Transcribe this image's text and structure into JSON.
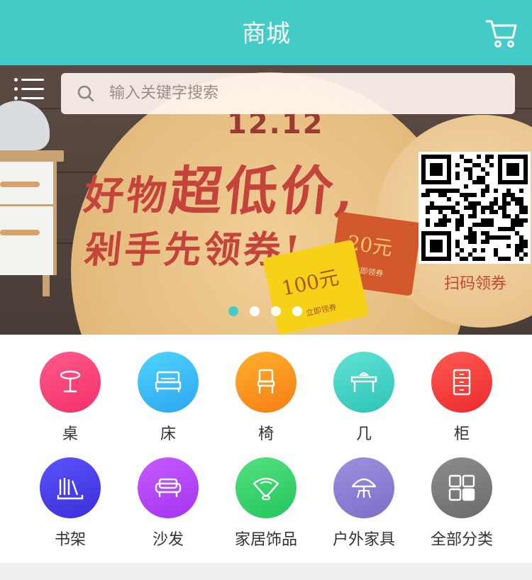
{
  "header": {
    "title": "商城",
    "cart_icon": "cart-icon"
  },
  "colors": {
    "accent": "#43cbc8",
    "slogan": "#c4433a"
  },
  "search": {
    "placeholder": "输入关键字搜索",
    "menu_icon": "menu-icon",
    "search_icon": "search-icon"
  },
  "banner": {
    "date": "12.12",
    "slogan_line1_a": "好物",
    "slogan_line1_b": "超低价,",
    "slogan_line2": "剁手先领券!",
    "coupon_small": {
      "value": "20元",
      "action": "立即领券"
    },
    "coupon_large": {
      "value": "100元",
      "action": "立即领券"
    },
    "qr_caption": "扫码领券",
    "slides_total": 4,
    "active_slide": 1
  },
  "categories": [
    {
      "label": "桌",
      "icon": "table-icon",
      "color_from": "#ff5a8a",
      "color_to": "#f3306a"
    },
    {
      "label": "床",
      "icon": "bed-icon",
      "color_from": "#4fd4ff",
      "color_to": "#2ba6f0"
    },
    {
      "label": "椅",
      "icon": "chair-icon",
      "color_from": "#ffb02e",
      "color_to": "#f57e12"
    },
    {
      "label": "几",
      "icon": "tea-table-icon",
      "color_from": "#5fe3d4",
      "color_to": "#2fc3b7"
    },
    {
      "label": "柜",
      "icon": "cabinet-icon",
      "color_from": "#ff5a52",
      "color_to": "#ec2b2b"
    },
    {
      "label": "书架",
      "icon": "bookshelf-icon",
      "color_from": "#5b53ff",
      "color_to": "#3a2fd8"
    },
    {
      "label": "沙发",
      "icon": "sofa-icon",
      "color_from": "#c65bff",
      "color_to": "#a335f0"
    },
    {
      "label": "家居饰品",
      "icon": "fan-icon",
      "color_from": "#52e27e",
      "color_to": "#24c45d"
    },
    {
      "label": "户外家具",
      "icon": "parasol-icon",
      "color_from": "#9d8fe0",
      "color_to": "#7c6fc7"
    },
    {
      "label": "全部分类",
      "icon": "grid-icon",
      "color_from": "#8d8d8d",
      "color_to": "#6b6b6b"
    }
  ]
}
